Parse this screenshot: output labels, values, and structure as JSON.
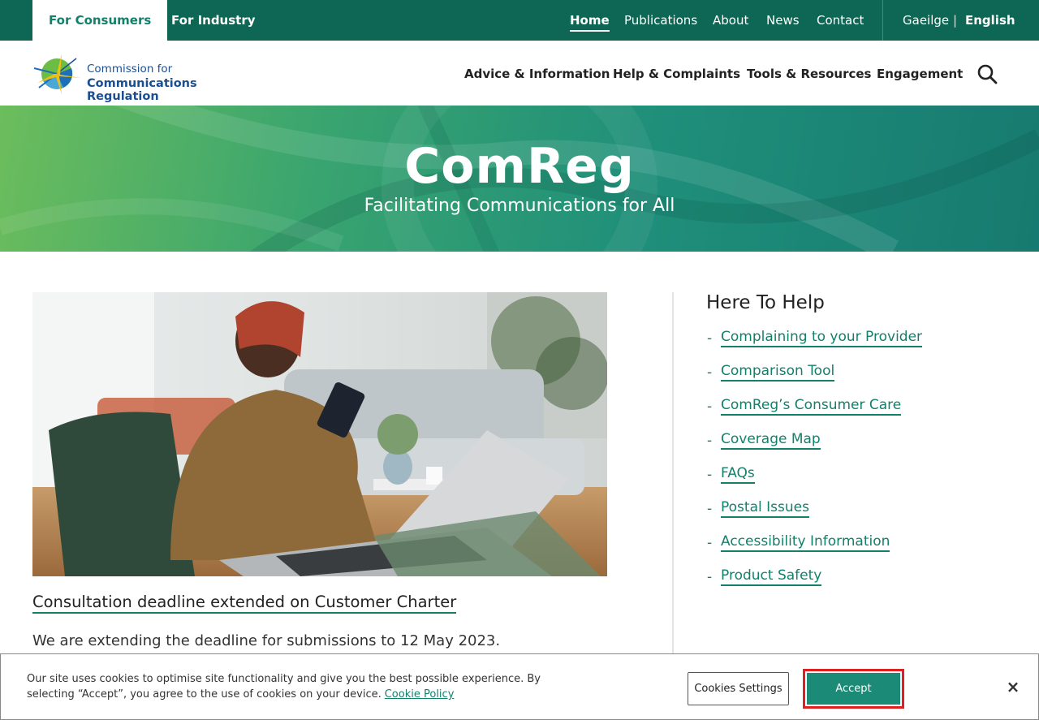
{
  "topbar": {
    "tabs": [
      {
        "label": "For Consumers"
      },
      {
        "label": "For Industry"
      }
    ],
    "utility": [
      {
        "label": "Home"
      },
      {
        "label": "Publications"
      },
      {
        "label": "About"
      },
      {
        "label": "News"
      },
      {
        "label": "Contact"
      }
    ],
    "language": {
      "irish": "Gaeilge",
      "separator": "|",
      "english": "English"
    },
    "colors": {
      "bar": "#0e6655",
      "accent": "#12806b"
    }
  },
  "logo": {
    "line1": "Commission for",
    "line2": "Communications Regulation"
  },
  "main_nav": [
    {
      "label": "Advice & Information"
    },
    {
      "label": "Help & Complaints"
    },
    {
      "label": "Tools & Resources"
    },
    {
      "label": "Engagement"
    }
  ],
  "search": {
    "icon": "search-icon"
  },
  "hero": {
    "title": "ComReg",
    "subtitle": "Facilitating Communications for All"
  },
  "feature": {
    "image": "woman-using-phone-with-laptop",
    "link_text": "Consultation deadline extended on Customer Charter",
    "description": "We are extending the deadline for submissions to 12 May 2023."
  },
  "help": {
    "title": "Here To Help",
    "links": [
      {
        "label": "Complaining to your Provider"
      },
      {
        "label": "Comparison Tool"
      },
      {
        "label": "ComReg’s Consumer Care"
      },
      {
        "label": "Coverage Map"
      },
      {
        "label": "FAQs"
      },
      {
        "label": "Postal Issues"
      },
      {
        "label": "Accessibility Information"
      },
      {
        "label": "Product Safety"
      }
    ],
    "bullet": "-"
  },
  "cookie": {
    "text": "Our site uses cookies to optimise site functionality and give you the best possible experience. By selecting “Accept”, you agree to the use of cookies on your device.",
    "policy_link": "Cookie Policy",
    "settings_label": "Cookies Settings",
    "accept_label": "Accept",
    "close_glyph": "×"
  }
}
